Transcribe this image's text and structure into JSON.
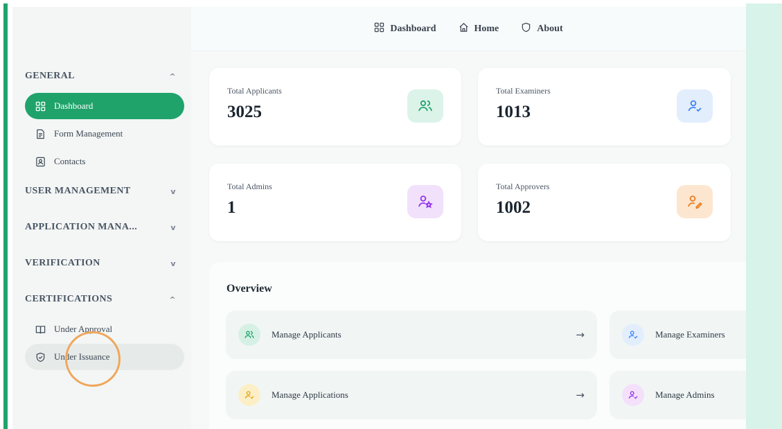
{
  "header": {
    "links": [
      {
        "label": "Dashboard",
        "icon": "grid-icon"
      },
      {
        "label": "Home",
        "icon": "home-icon"
      },
      {
        "label": "About",
        "icon": "shield-icon"
      }
    ]
  },
  "sidebar": {
    "general": {
      "label": "GENERAL",
      "state": "expanded"
    },
    "general_items": [
      {
        "label": "Dashboard",
        "icon": "grid-icon",
        "active": true
      },
      {
        "label": "Form Management",
        "icon": "document-icon"
      },
      {
        "label": "Contacts",
        "icon": "contact-card-icon"
      }
    ],
    "user_management": {
      "label": "USER MANAGEMENT"
    },
    "application_management": {
      "label": "APPLICATION MANA..."
    },
    "verification": {
      "label": "VERIFICATION"
    },
    "certifications": {
      "label": "CERTIFICATIONS",
      "state": "expanded"
    },
    "certification_items": [
      {
        "label": "Under Approval",
        "icon": "book-icon"
      },
      {
        "label": "Under Issuance",
        "icon": "shield-check-icon",
        "hovered": true
      }
    ]
  },
  "stats": {
    "applicants": {
      "label": "Total Applicants",
      "value": "3025",
      "color": "#1fa36b"
    },
    "examiners": {
      "label": "Total Examiners",
      "value": "1013",
      "color": "#3b82f6"
    },
    "admins": {
      "label": "Total Admins",
      "value": "1",
      "color": "#9333ea"
    },
    "approvers": {
      "label": "Total Approvers",
      "value": "1002",
      "color": "#ea7c1f"
    }
  },
  "overview": {
    "title": "Overview",
    "items": [
      {
        "label": "Manage Applicants",
        "icon": "users-icon"
      },
      {
        "label": "Manage Examiners",
        "icon": "user-check-icon"
      },
      {
        "label": "Manage Applications",
        "icon": "user-check-icon"
      },
      {
        "label": "Manage Admins",
        "icon": "user-check-icon"
      }
    ],
    "arrow": "→"
  },
  "chevrons": {
    "up": "^",
    "down": "v"
  },
  "colors": {
    "accent": "#1fa36b",
    "highlight": "#f0a65a"
  }
}
